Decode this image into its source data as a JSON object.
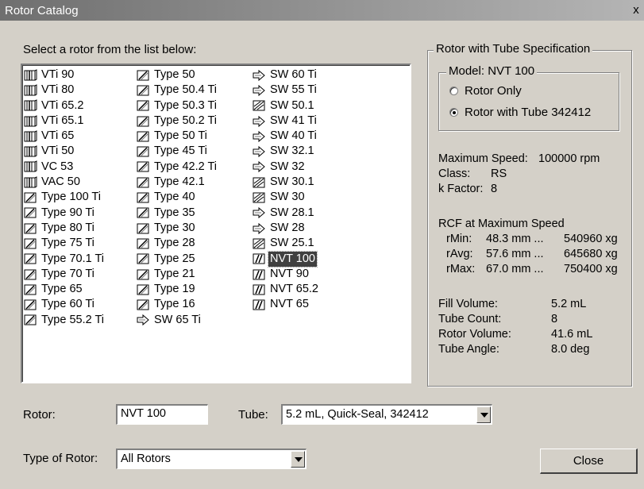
{
  "window": {
    "title": "Rotor Catalog",
    "close_glyph": "x"
  },
  "list": {
    "label": "Select a rotor from the list below:",
    "columns": [
      [
        {
          "label": "VTi 90",
          "icon": "vertical-rotor-icon"
        },
        {
          "label": "VTi 80",
          "icon": "vertical-rotor-icon"
        },
        {
          "label": "VTi 65.2",
          "icon": "vertical-rotor-icon"
        },
        {
          "label": "VTi 65.1",
          "icon": "vertical-rotor-icon"
        },
        {
          "label": "VTi 65",
          "icon": "vertical-rotor-icon"
        },
        {
          "label": "VTi 50",
          "icon": "vertical-rotor-icon"
        },
        {
          "label": "VC 53",
          "icon": "vertical-rotor-icon"
        },
        {
          "label": "VAC 50",
          "icon": "vertical-rotor-icon"
        },
        {
          "label": "Type 100 Ti",
          "icon": "fixed-angle-rotor-icon"
        },
        {
          "label": "Type 90 Ti",
          "icon": "fixed-angle-rotor-icon"
        },
        {
          "label": "Type 80 Ti",
          "icon": "fixed-angle-rotor-icon"
        },
        {
          "label": "Type 75 Ti",
          "icon": "fixed-angle-rotor-icon"
        },
        {
          "label": "Type 70.1 Ti",
          "icon": "fixed-angle-rotor-icon"
        },
        {
          "label": "Type 70 Ti",
          "icon": "fixed-angle-rotor-icon"
        },
        {
          "label": "Type 65",
          "icon": "fixed-angle-rotor-icon"
        },
        {
          "label": "Type 60 Ti",
          "icon": "fixed-angle-rotor-icon"
        },
        {
          "label": "Type 55.2 Ti",
          "icon": "fixed-angle-rotor-icon"
        }
      ],
      [
        {
          "label": "Type 50",
          "icon": "fixed-angle-rotor-icon"
        },
        {
          "label": "Type 50.4 Ti",
          "icon": "fixed-angle-rotor-icon"
        },
        {
          "label": "Type 50.3 Ti",
          "icon": "fixed-angle-rotor-icon"
        },
        {
          "label": "Type 50.2 Ti",
          "icon": "fixed-angle-rotor-icon"
        },
        {
          "label": "Type 50 Ti",
          "icon": "fixed-angle-rotor-icon"
        },
        {
          "label": "Type 45 Ti",
          "icon": "fixed-angle-rotor-icon"
        },
        {
          "label": "Type 42.2 Ti",
          "icon": "fixed-angle-rotor-icon"
        },
        {
          "label": "Type 42.1",
          "icon": "fixed-angle-rotor-icon"
        },
        {
          "label": "Type 40",
          "icon": "fixed-angle-rotor-icon"
        },
        {
          "label": "Type 35",
          "icon": "fixed-angle-rotor-icon"
        },
        {
          "label": "Type 30",
          "icon": "fixed-angle-rotor-icon"
        },
        {
          "label": "Type 28",
          "icon": "fixed-angle-rotor-icon"
        },
        {
          "label": "Type 25",
          "icon": "fixed-angle-rotor-icon"
        },
        {
          "label": "Type 21",
          "icon": "fixed-angle-rotor-icon"
        },
        {
          "label": "Type 19",
          "icon": "fixed-angle-rotor-icon"
        },
        {
          "label": "Type 16",
          "icon": "fixed-angle-rotor-icon"
        },
        {
          "label": "SW 65 Ti",
          "icon": "swinging-bucket-rotor-icon"
        }
      ],
      [
        {
          "label": "SW 60 Ti",
          "icon": "swinging-bucket-rotor-icon"
        },
        {
          "label": "SW 55 Ti",
          "icon": "swinging-bucket-rotor-icon"
        },
        {
          "label": "SW 50.1",
          "icon": "swinging-bucket-box-icon"
        },
        {
          "label": "SW 41 Ti",
          "icon": "swinging-bucket-rotor-icon"
        },
        {
          "label": "SW 40 Ti",
          "icon": "swinging-bucket-rotor-icon"
        },
        {
          "label": "SW 32.1",
          "icon": "swinging-bucket-rotor-icon"
        },
        {
          "label": "SW 32",
          "icon": "swinging-bucket-rotor-icon"
        },
        {
          "label": "SW 30.1",
          "icon": "swinging-bucket-box-icon"
        },
        {
          "label": "SW 30",
          "icon": "swinging-bucket-box-icon"
        },
        {
          "label": "SW 28.1",
          "icon": "swinging-bucket-rotor-icon"
        },
        {
          "label": "SW 28",
          "icon": "swinging-bucket-rotor-icon"
        },
        {
          "label": "SW 25.1",
          "icon": "swinging-bucket-box-icon"
        },
        {
          "label": "NVT 100",
          "icon": "near-vertical-rotor-icon",
          "selected": true
        },
        {
          "label": "NVT 90",
          "icon": "near-vertical-rotor-icon"
        },
        {
          "label": "NVT 65.2",
          "icon": "near-vertical-rotor-icon"
        },
        {
          "label": "NVT 65",
          "icon": "near-vertical-rotor-icon"
        }
      ]
    ]
  },
  "spec": {
    "group_title": "Rotor with Tube Specification",
    "model_title": "Model: NVT 100",
    "radio_rotor_only": "Rotor Only",
    "radio_rotor_with_tube": "Rotor with Tube 342412",
    "selected_option": "radio_rotor_with_tube",
    "max_speed_label": "Maximum Speed:",
    "max_speed_value": "100000 rpm",
    "class_label": "Class:",
    "class_value": "RS",
    "kfactor_label": "k Factor:",
    "kfactor_value": "8",
    "rcf_title": "RCF at Maximum Speed",
    "rmin_label": "rMin:",
    "rmin_mm": "48.3 mm ...",
    "rmin_xg": "540960 xg",
    "ravg_label": "rAvg:",
    "ravg_mm": "57.6 mm ...",
    "ravg_xg": "645680 xg",
    "rmax_label": "rMax:",
    "rmax_mm": "67.0 mm ...",
    "rmax_xg": "750400 xg",
    "fill_label": "Fill Volume:",
    "fill_value": "5.2 mL",
    "count_label": "Tube Count:",
    "count_value": "8",
    "rotorvol_label": "Rotor Volume:",
    "rotorvol_value": "41.6 mL",
    "angle_label": "Tube Angle:",
    "angle_value": "8.0 deg"
  },
  "form": {
    "rotor_label": "Rotor:",
    "rotor_value": "NVT 100",
    "tube_label": "Tube:",
    "tube_value": "5.2 mL, Quick-Seal, 342412",
    "type_label": "Type of Rotor:",
    "type_value": "All Rotors",
    "close_label": "Close"
  }
}
